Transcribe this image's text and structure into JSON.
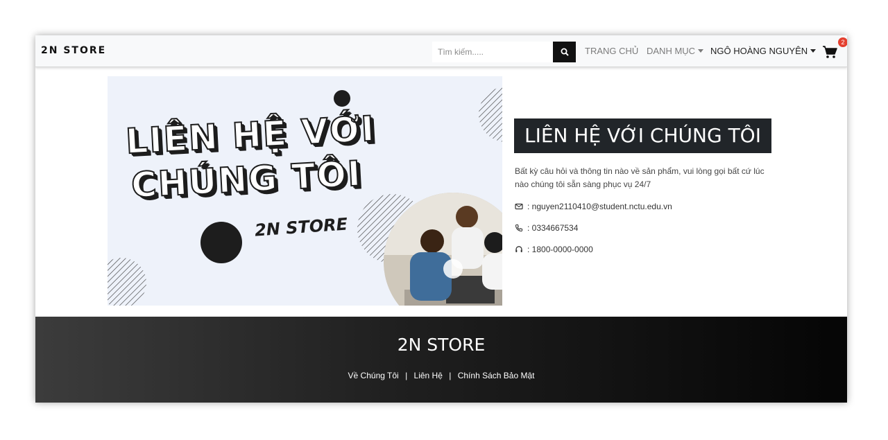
{
  "navbar": {
    "brand": "2N STORE",
    "search_placeholder": "Tìm kiếm.....",
    "links": {
      "home": "TRANG CHỦ",
      "category": "DANH MỤC",
      "user": "NGÔ HOÀNG NGUYÊN"
    },
    "cart_count": "2"
  },
  "hero": {
    "line1": "LIÊN HỆ VỚI",
    "line2": "CHÚNG TÔI",
    "store": "2N STORE"
  },
  "contact": {
    "title": "LIÊN HỆ VỚI CHÚNG TÔI",
    "description": "Bất kỳ câu hỏi và thông tin nào về sản phẩm, vui lòng gọi bất cứ lúc nào chúng tôi sẵn sàng phục vụ 24/7",
    "email": ": nguyen2110410@student.nctu.edu.vn",
    "phone": ": 0334667534",
    "hotline": ": 1800-0000-0000"
  },
  "footer": {
    "brand": "2N STORE",
    "links": [
      "Về Chúng Tôi",
      "Liên Hệ",
      "Chính Sách Bảo Mật"
    ],
    "separator": "|"
  },
  "colors": {
    "navbar_bg": "#f8f9fa",
    "dark": "#212529",
    "badge": "#e4402f"
  }
}
